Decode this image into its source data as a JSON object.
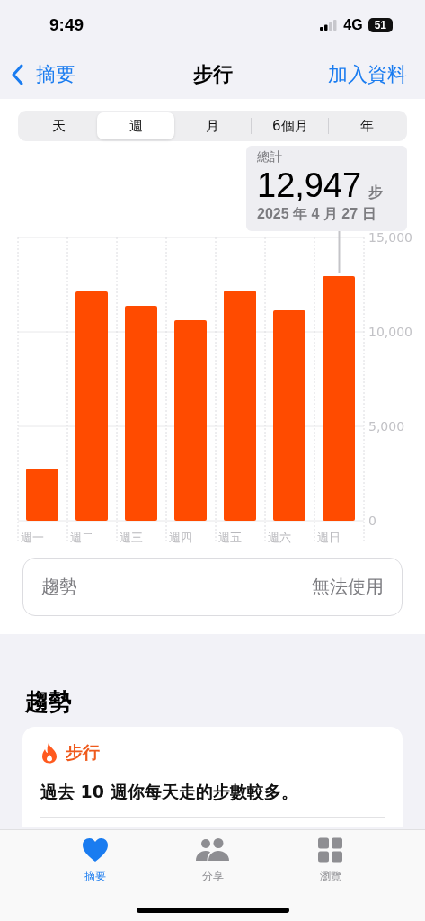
{
  "status_bar": {
    "time": "9:49",
    "network": "4G",
    "battery": "51"
  },
  "nav": {
    "back": "摘要",
    "title": "步行",
    "action": "加入資料"
  },
  "segments": [
    {
      "label": "天",
      "selected": false
    },
    {
      "label": "週",
      "selected": true
    },
    {
      "label": "月",
      "selected": false
    },
    {
      "label": "6個月",
      "selected": false
    },
    {
      "label": "年",
      "selected": false
    }
  ],
  "callout": {
    "label": "總計",
    "value": "12,947",
    "unit": "步",
    "date": "2025 年 4 月 27 日"
  },
  "chart_data": {
    "type": "bar",
    "categories": [
      "週一",
      "週二",
      "週三",
      "週四",
      "週五",
      "週六",
      "週日"
    ],
    "series": [
      {
        "color": "#ff4b00",
        "values": [
          2760,
          12140,
          11380,
          10620,
          12190,
          11140,
          12950
        ]
      }
    ],
    "ylim": [
      0,
      15000
    ],
    "yticks": [
      {
        "value": 0,
        "label": "0"
      },
      {
        "value": 5000,
        "label": "5,000"
      },
      {
        "value": 10000,
        "label": "10,000"
      },
      {
        "value": 15000,
        "label": "15,000"
      }
    ]
  },
  "trend_row": {
    "label": "趨勢",
    "value": "無法使用"
  },
  "trends": {
    "heading": "趨勢",
    "card": {
      "title": "步行",
      "text": "過去 10 週你每天走的步數較多。"
    }
  },
  "tab_bar": [
    {
      "label": "摘要",
      "selected": true
    },
    {
      "label": "分享",
      "selected": false
    },
    {
      "label": "瀏覽",
      "selected": false
    }
  ]
}
